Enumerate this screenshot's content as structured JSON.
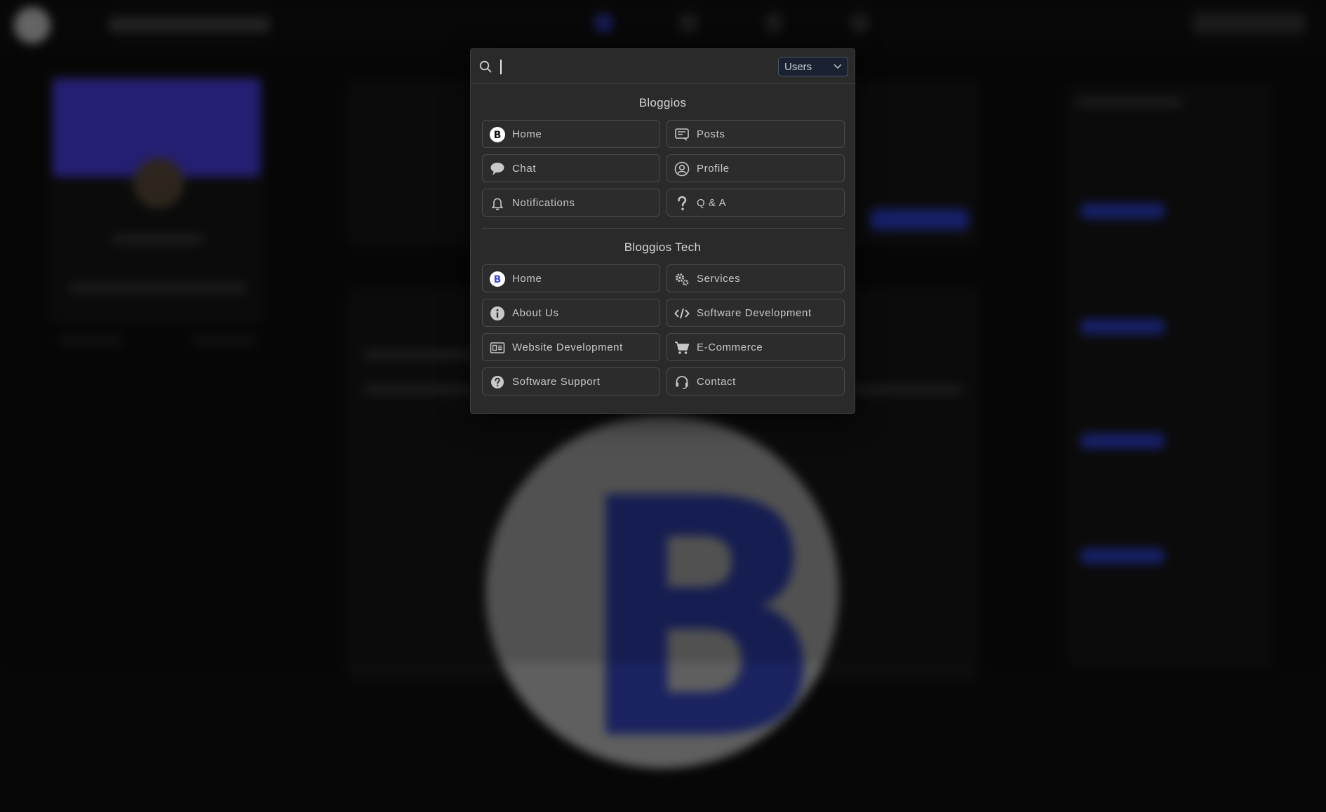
{
  "search": {
    "value": "",
    "scope_selected": "Users"
  },
  "sections": [
    {
      "title": "Bloggios",
      "items": [
        {
          "label": "Home",
          "icon": "bloggios-logo-icon"
        },
        {
          "label": "Posts",
          "icon": "posts-icon"
        },
        {
          "label": "Chat",
          "icon": "chat-bubble-icon"
        },
        {
          "label": "Profile",
          "icon": "user-circle-icon"
        },
        {
          "label": "Notifications",
          "icon": "bell-icon"
        },
        {
          "label": "Q & A",
          "icon": "question-mark-icon"
        }
      ]
    },
    {
      "title": "Bloggios Tech",
      "items": [
        {
          "label": "Home",
          "icon": "bloggios-tech-logo-icon"
        },
        {
          "label": "Services",
          "icon": "gears-icon"
        },
        {
          "label": "About Us",
          "icon": "info-icon"
        },
        {
          "label": "Software Development",
          "icon": "code-icon"
        },
        {
          "label": "Website Development",
          "icon": "website-icon"
        },
        {
          "label": "E-Commerce",
          "icon": "cart-icon"
        },
        {
          "label": "Software Support",
          "icon": "question-circle-icon"
        },
        {
          "label": "Contact",
          "icon": "headset-icon"
        }
      ]
    }
  ],
  "colors": {
    "accent": "#2b3fd6",
    "modal_bg": "#2a2a2a",
    "banner": "#4a3cf0"
  }
}
